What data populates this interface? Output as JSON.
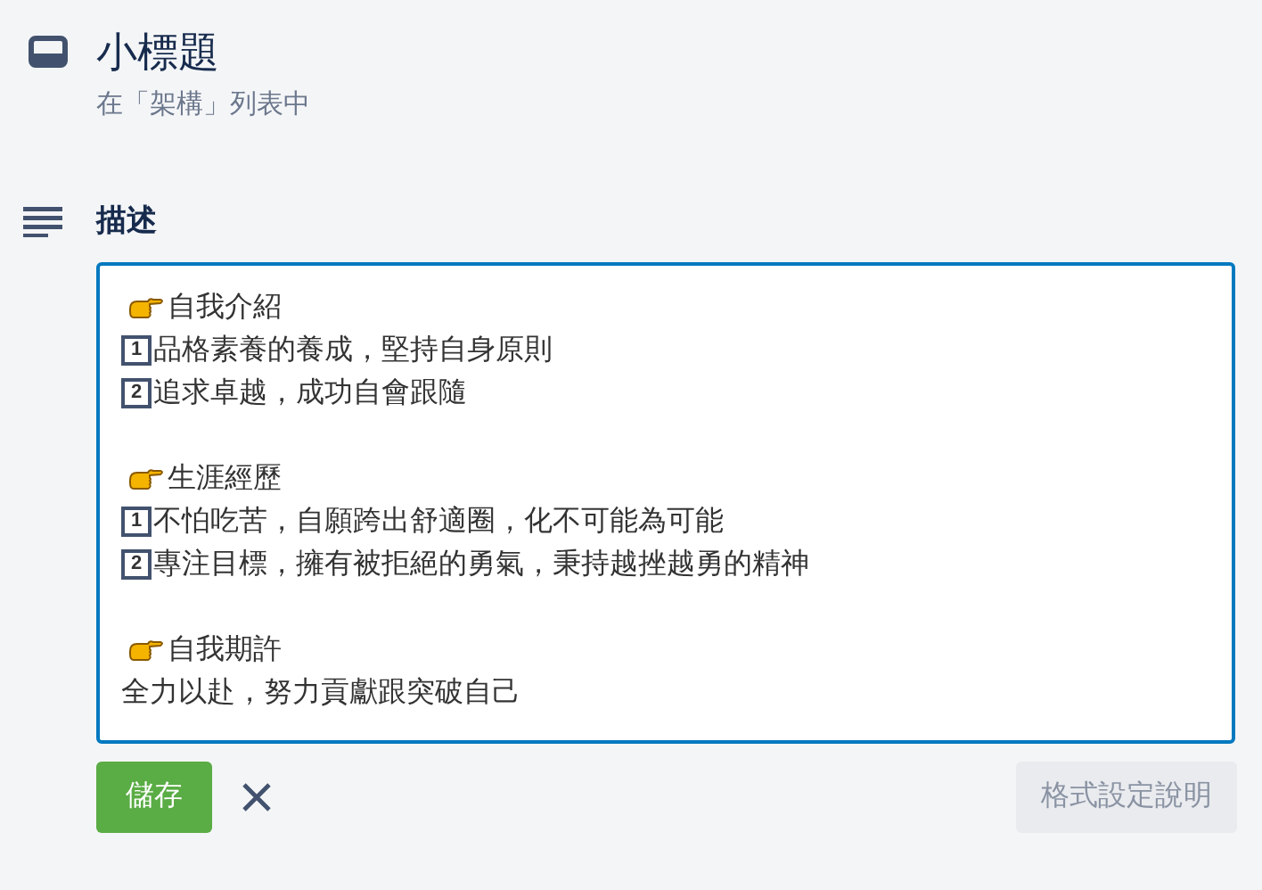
{
  "card": {
    "title": "小標題",
    "subtitle": "在「架構」列表中"
  },
  "description": {
    "heading": "描述",
    "sections": [
      {
        "heading": "自我介紹",
        "lines": [
          {
            "number": "1",
            "text": "品格素養的養成，堅持自身原則"
          },
          {
            "number": "2",
            "text": "追求卓越，成功自會跟隨"
          }
        ]
      },
      {
        "heading": "生涯經歷",
        "lines": [
          {
            "number": "1",
            "text": "不怕吃苦，自願跨出舒適圈，化不可能為可能"
          },
          {
            "number": "2",
            "text": "專注目標，擁有被拒絕的勇氣，秉持越挫越勇的精神"
          }
        ]
      },
      {
        "heading": "自我期許",
        "lines": [
          {
            "text": "全力以赴，努力貢獻跟突破自己"
          }
        ]
      }
    ]
  },
  "actions": {
    "save": "儲存",
    "help": "格式設定說明"
  }
}
